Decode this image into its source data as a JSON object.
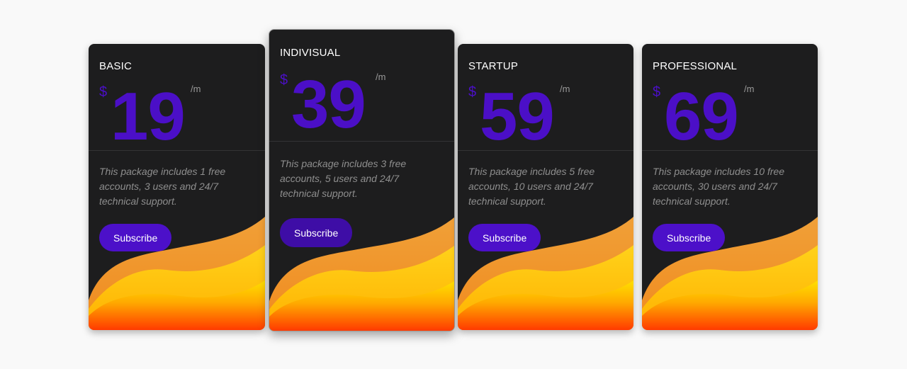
{
  "plans": [
    {
      "name": "BASIC",
      "currency": "$",
      "price": "19",
      "period": "/m",
      "description": "This package includes 1 free accounts, 3 users and 24/7 technical support.",
      "button_label": "Subscribe"
    },
    {
      "name": "INDIVISUAL",
      "currency": "$",
      "price": "39",
      "period": "/m",
      "description": "This package includes 3 free accounts, 5 users and 24/7 technical support.",
      "button_label": "Subscribe"
    },
    {
      "name": "STARTUP",
      "currency": "$",
      "price": "59",
      "period": "/m",
      "description": "This package includes 5 free accounts, 10 users and 24/7 technical support.",
      "button_label": "Subscribe"
    },
    {
      "name": "PROFESSIONAL",
      "currency": "$",
      "price": "69",
      "period": "/m",
      "description": "This package includes 10 free accounts, 30 users and 24/7 technical support.",
      "button_label": "Subscribe"
    }
  ],
  "colors": {
    "card_background": "#1d1d1e",
    "accent_purple": "#4c10c9",
    "wave_orange": "#f5a623",
    "wave_yellow": "#ffd400",
    "wave_red": "#ff3d00"
  }
}
